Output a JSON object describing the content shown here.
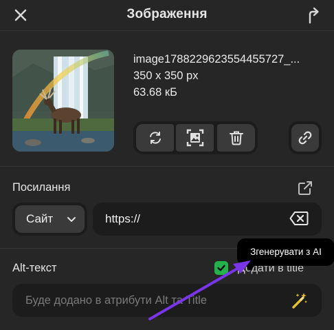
{
  "header": {
    "title": "Зображення"
  },
  "image": {
    "file_name": "image1788229623554455727_...",
    "dimensions": "350 x 350 px",
    "size": "63.68 кБ"
  },
  "link": {
    "label": "Посилання",
    "type_selected": "Сайт",
    "url_value": "https://"
  },
  "alt": {
    "label": "Alt-текст",
    "add_title_label": "Додати в title",
    "add_title_checked": true,
    "placeholder": "Буде додано в атрибути Alt та Title",
    "tooltip": "Згенерувати з AI"
  },
  "colors": {
    "background": "#262626",
    "field": "#1c1c1c",
    "button": "#3a3a3a",
    "check": "#23b24b",
    "wand": "#e8c232",
    "arrow": "#7b35e8"
  },
  "icons": [
    "close-icon",
    "share-icon",
    "replace-icon",
    "crop-icon",
    "trash-icon",
    "link-icon",
    "external-link-icon",
    "chevron-down-icon",
    "backspace-icon",
    "check-icon",
    "magic-wand-icon"
  ]
}
